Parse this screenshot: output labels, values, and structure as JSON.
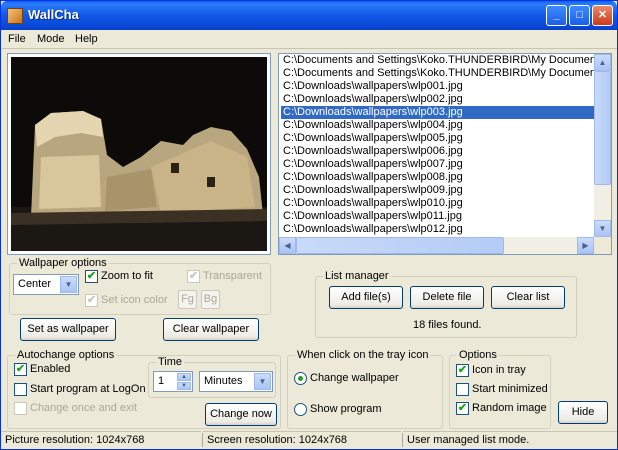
{
  "window": {
    "title": "WallCha"
  },
  "menu": {
    "file": "File",
    "mode": "Mode",
    "help": "Help"
  },
  "file_list": {
    "items": [
      "C:\\Documents and Settings\\Koko.THUNDERBIRD\\My Document",
      "C:\\Documents and Settings\\Koko.THUNDERBIRD\\My Document",
      "C:\\Downloads\\wallpapers\\wlp001.jpg",
      "C:\\Downloads\\wallpapers\\wlp002.jpg",
      "C:\\Downloads\\wallpapers\\wlp003.jpg",
      "C:\\Downloads\\wallpapers\\wlp004.jpg",
      "C:\\Downloads\\wallpapers\\wlp005.jpg",
      "C:\\Downloads\\wallpapers\\wlp006.jpg",
      "C:\\Downloads\\wallpapers\\wlp007.jpg",
      "C:\\Downloads\\wallpapers\\wlp008.jpg",
      "C:\\Downloads\\wallpapers\\wlp009.jpg",
      "C:\\Downloads\\wallpapers\\wlp010.jpg",
      "C:\\Downloads\\wallpapers\\wlp011.jpg",
      "C:\\Downloads\\wallpapers\\wlp012.jpg"
    ],
    "selected_index": 4
  },
  "wallpaper_options": {
    "label": "Wallpaper options",
    "position_value": "Center",
    "zoom_to_fit": "Zoom to fit",
    "transparent": "Transparent",
    "set_icon_color": "Set icon color",
    "fg": "Fg",
    "bg": "Bg",
    "set_as_wallpaper": "Set as wallpaper",
    "clear_wallpaper": "Clear wallpaper"
  },
  "list_manager": {
    "label": "List manager",
    "add_files": "Add file(s)",
    "delete_file": "Delete file",
    "clear_list": "Clear list",
    "status": "18 files found."
  },
  "autochange": {
    "label": "Autochange options",
    "enabled": "Enabled",
    "start_at_logon": "Start program at LogOn",
    "change_once": "Change once and exit",
    "time_label": "Time",
    "time_value": "1",
    "unit_value": "Minutes",
    "change_now": "Change now"
  },
  "tray_click": {
    "label": "When click on the tray icon",
    "change_wallpaper": "Change wallpaper",
    "show_program": "Show program"
  },
  "options": {
    "label": "Options",
    "icon_in_tray": "Icon in tray",
    "start_minimized": "Start minimized",
    "random_image": "Random image",
    "hide": "Hide"
  },
  "statusbar": {
    "picture_resolution": "Picture resolution: 1024x768",
    "screen_resolution": "Screen resolution: 1024x768",
    "mode": "User managed list mode."
  }
}
